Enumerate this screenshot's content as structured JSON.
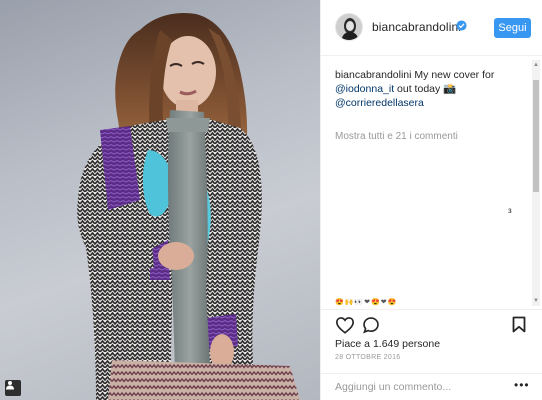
{
  "post": {
    "photo_alt": "post-photo",
    "tag_icon": "person-tag-icon"
  },
  "header": {
    "username": "biancabrandolini",
    "verified_icon": "verified-badge-icon",
    "follow_label": "Segui",
    "follow_color": "#3897f0"
  },
  "caption": {
    "user": "biancabrandolini",
    "text_before_link": " My new cover for",
    "link_1": "@iodonna_it",
    "text_mid": " out today 📸",
    "link_2": "@corrieredellasera"
  },
  "comments": {
    "view_all_label": "Mostra tutti e 21 i commenti",
    "stray_glyph": "з",
    "cut_off_emoji": "😍🙌👀❤😍❤😍"
  },
  "actions": {
    "like_icon": "heart-icon",
    "comment_icon": "comment-bubble-icon",
    "save_icon": "bookmark-icon"
  },
  "likes_label": "Piace a 1.649 persone",
  "date_label": "28 OTTOBRE 2016",
  "add_comment": {
    "placeholder": "Aggiungi un commento...",
    "more_label": "•••"
  },
  "colors": {
    "link": "#003569",
    "muted": "#999999",
    "text": "#262626",
    "divider": "#efefef"
  }
}
